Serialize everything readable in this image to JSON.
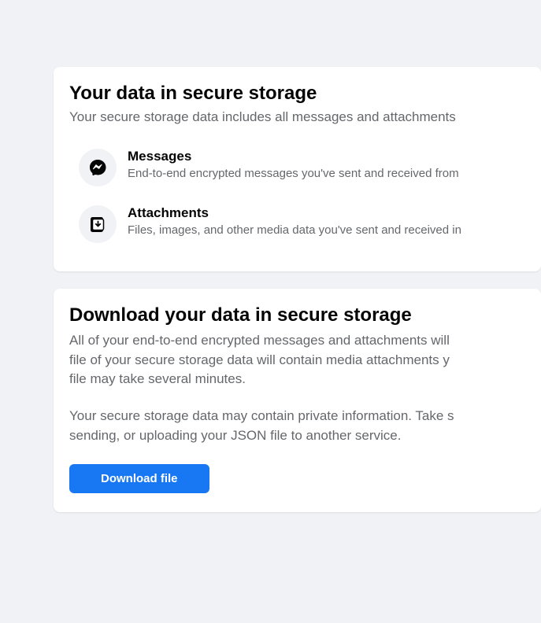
{
  "section1": {
    "title": "Your data in secure storage",
    "subtitle": "Your secure storage data includes all messages and attachments",
    "items": [
      {
        "title": "Messages",
        "desc": "End-to-end encrypted messages you've sent and received from"
      },
      {
        "title": "Attachments",
        "desc": "Files, images, and other media data you've sent and received in"
      }
    ]
  },
  "section2": {
    "title": "Download your data in secure storage",
    "para1_l1": "All of your end-to-end encrypted messages and attachments will",
    "para1_l2": "file of your secure storage data will contain media attachments y",
    "para1_l3": "file may take several minutes.",
    "para2_l1": "Your secure storage data may contain private information. Take s",
    "para2_l2": "sending, or uploading your JSON file to another service.",
    "button": "Download file"
  }
}
